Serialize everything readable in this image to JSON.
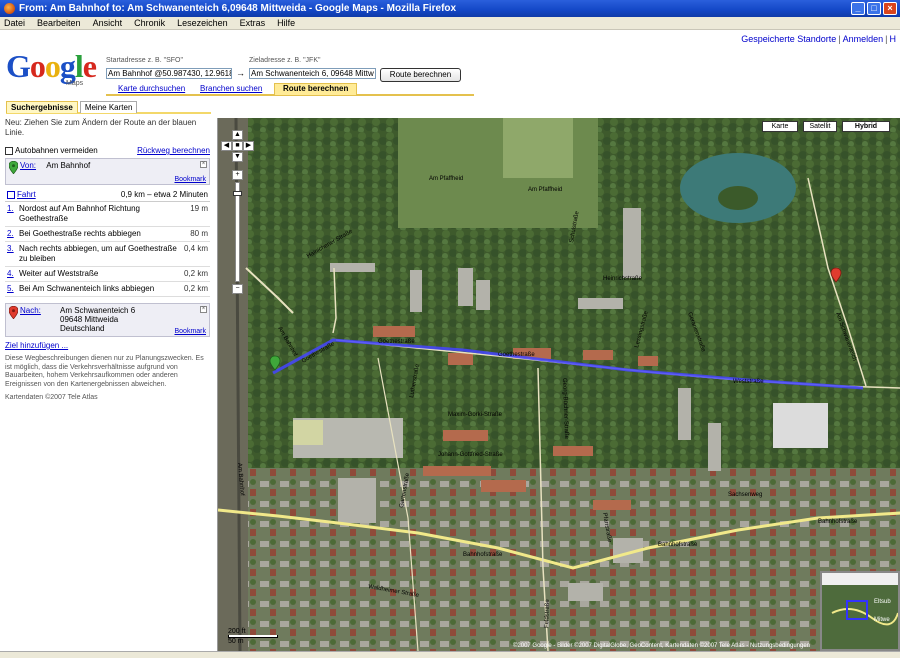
{
  "window": {
    "title": "From: Am Bahnhof  to: Am Schwanenteich 6,09648 Mittweida - Google Maps - Mozilla Firefox"
  },
  "menubar": [
    "Datei",
    "Bearbeiten",
    "Ansicht",
    "Chronik",
    "Lesezeichen",
    "Extras",
    "Hilfe"
  ],
  "toplinks": {
    "saved": "Gespeicherte Standorte",
    "login": "Anmelden",
    "help": "H"
  },
  "logo": {
    "text": "Google",
    "sub": "Maps"
  },
  "route": {
    "start_label": "Startadresse z. B. \"SFO\"",
    "start_value": "Am Bahnhof @50.987430, 12.96186",
    "dest_label": "Zieladresse z. B. \"JFK\"",
    "dest_value": "Am Schwanenteich 6, 09648 Mittw",
    "button": "Route berechnen"
  },
  "subtabs": [
    "Karte durchsuchen",
    "Branchen suchen",
    "Route berechnen"
  ],
  "tabs": [
    "Suchergebnisse",
    "Meine Karten"
  ],
  "panel": {
    "hint": "Neu: Ziehen Sie zum Ändern der Route an der blauen Linie.",
    "avoid_highways": "Autobahnen vermeiden",
    "reverse": "Rückweg berechnen",
    "from_label": "Von:",
    "from_value": "Am Bahnhof",
    "bookmark": "Bookmark",
    "fahrt_label": "Fahrt",
    "fahrt_summary": "0,9 km – etwa 2 Minuten",
    "steps": [
      {
        "num": "1.",
        "text": "Nordost auf Am Bahnhof Richtung Goethestraße",
        "dist": "19 m"
      },
      {
        "num": "2.",
        "text": "Bei Goethestraße rechts abbiegen",
        "dist": "80 m"
      },
      {
        "num": "3.",
        "text": "Nach rechts abbiegen, um auf Goethestraße zu bleiben",
        "dist": "0,4 km"
      },
      {
        "num": "4.",
        "text": "Weiter auf Weststraße",
        "dist": "0,2 km"
      },
      {
        "num": "5.",
        "text": "Bei Am Schwanenteich links abbiegen",
        "dist": "0,2 km"
      }
    ],
    "to_label": "Nach:",
    "to_line1": "Am Schwanenteich 6",
    "to_line2": "09648 Mittweida",
    "to_line3": "Deutschland",
    "add_dest": "Ziel hinzufügen ...",
    "disclaimer": "Diese Wegbeschreibungen dienen nur zu Planungszwecken. Es ist möglich, dass die Verkehrsverhältnisse aufgrund von Bauarbeiten, hohem Verkehrsaufkommen oder anderen Ereignissen von den Kartenergebnissen abweichen.",
    "copyright": "Kartendaten ©2007 Tele Atlas"
  },
  "map": {
    "types": [
      "Karte",
      "Satellit",
      "Hybrid"
    ],
    "active_type": "Hybrid",
    "scale_top": "200 ft",
    "scale_bottom": "50 m",
    "copyright": "©2007 Google - Bilder ©2007 DigitalGlobe, GeoContent, Kartendaten ©2007 Tele Atlas - Nutzungsbedingungen",
    "route_color": "#4444ff",
    "streets": [
      "Am Pfaffheid",
      "Am Pfaffheid",
      "Schulstraße",
      "Heinrichstraße",
      "Hainichener Straße",
      "Goethestraße",
      "Goethestraße",
      "Goethestraße",
      "Weststraße",
      "Am Schwanenteich",
      "Am Bahnhof",
      "Am Bahnhof",
      "Maxim-Gorki-Straße",
      "Johann-Gottfried-Straße",
      "Bahnhofstraße",
      "Bahnhofstraße",
      "Georg-Büchner-Straße",
      "Lessingstraße",
      "Geranienstraße",
      "Lutherstraße",
      "Sachsenweg",
      "Pfarrstraße",
      "Gartenstraße",
      "Feldstraße",
      "Waldheimer Straße",
      "Bahnhofstraße"
    ]
  },
  "overview": {
    "labels": [
      "Eltsub",
      "Mitwe"
    ]
  }
}
